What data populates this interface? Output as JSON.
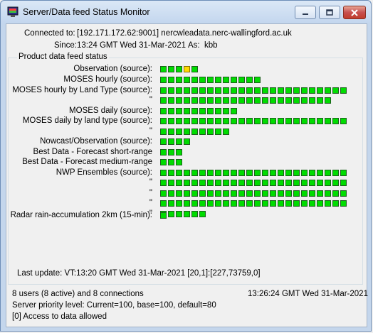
{
  "window": {
    "title": "Server/Data feed Status Monitor",
    "icon": "monitor-app-icon"
  },
  "connection": {
    "connected_label": "Connected to:",
    "connected_value": "[192.171.172.62:9001] nercwleadata.nerc-wallingford.ac.uk",
    "since_label": "Since:",
    "since_value": "13:24 GMT Wed 31-Mar-2021",
    "as_label": "As:",
    "as_value": "kbb"
  },
  "group_title": "Product data feed status",
  "status_colors": {
    "ok": "#00dc00",
    "warning": "#ffd800"
  },
  "feeds": [
    {
      "label": "Observation (source):",
      "squares": [
        "ok",
        "ok",
        "ok",
        "warning",
        "ok"
      ]
    },
    {
      "label": "MOSES hourly (source):",
      "count": 13
    },
    {
      "label": "MOSES hourly by Land Type (source):",
      "count": 24
    },
    {
      "label": "\"",
      "count": 22
    },
    {
      "label": "MOSES daily (source):",
      "count": 10
    },
    {
      "label": "MOSES daily by land type (source):",
      "count": 24
    },
    {
      "label": "\"",
      "count": 9
    },
    {
      "label": "Nowcast/Observation (source):",
      "count": 4
    },
    {
      "label": "Best Data - Forecast short-range",
      "count": 3
    },
    {
      "label": "Best Data - Forecast medium-range",
      "count": 3
    },
    {
      "label": "NWP Ensembles (source):",
      "count": 24
    },
    {
      "label": "\"",
      "count": 24
    },
    {
      "label": "\"",
      "count": 24
    },
    {
      "label": "\"",
      "count": 24
    },
    {
      "label": "\"",
      "count": 6
    },
    {
      "label": "Radar rain-accumulation 2km (15-min):",
      "count": 1
    }
  ],
  "last_update": "Last update: VT:13:20 GMT Wed 31-Mar-2021 [20,1]:[227,73759,0]",
  "footer": {
    "users": "8 users (8 active) and 8 connections",
    "clock": "13:26:24 GMT Wed 31-Mar-2021",
    "priority": "Server priority level: Current=100, base=100, default=80",
    "access": "[0] Access to data allowed"
  }
}
